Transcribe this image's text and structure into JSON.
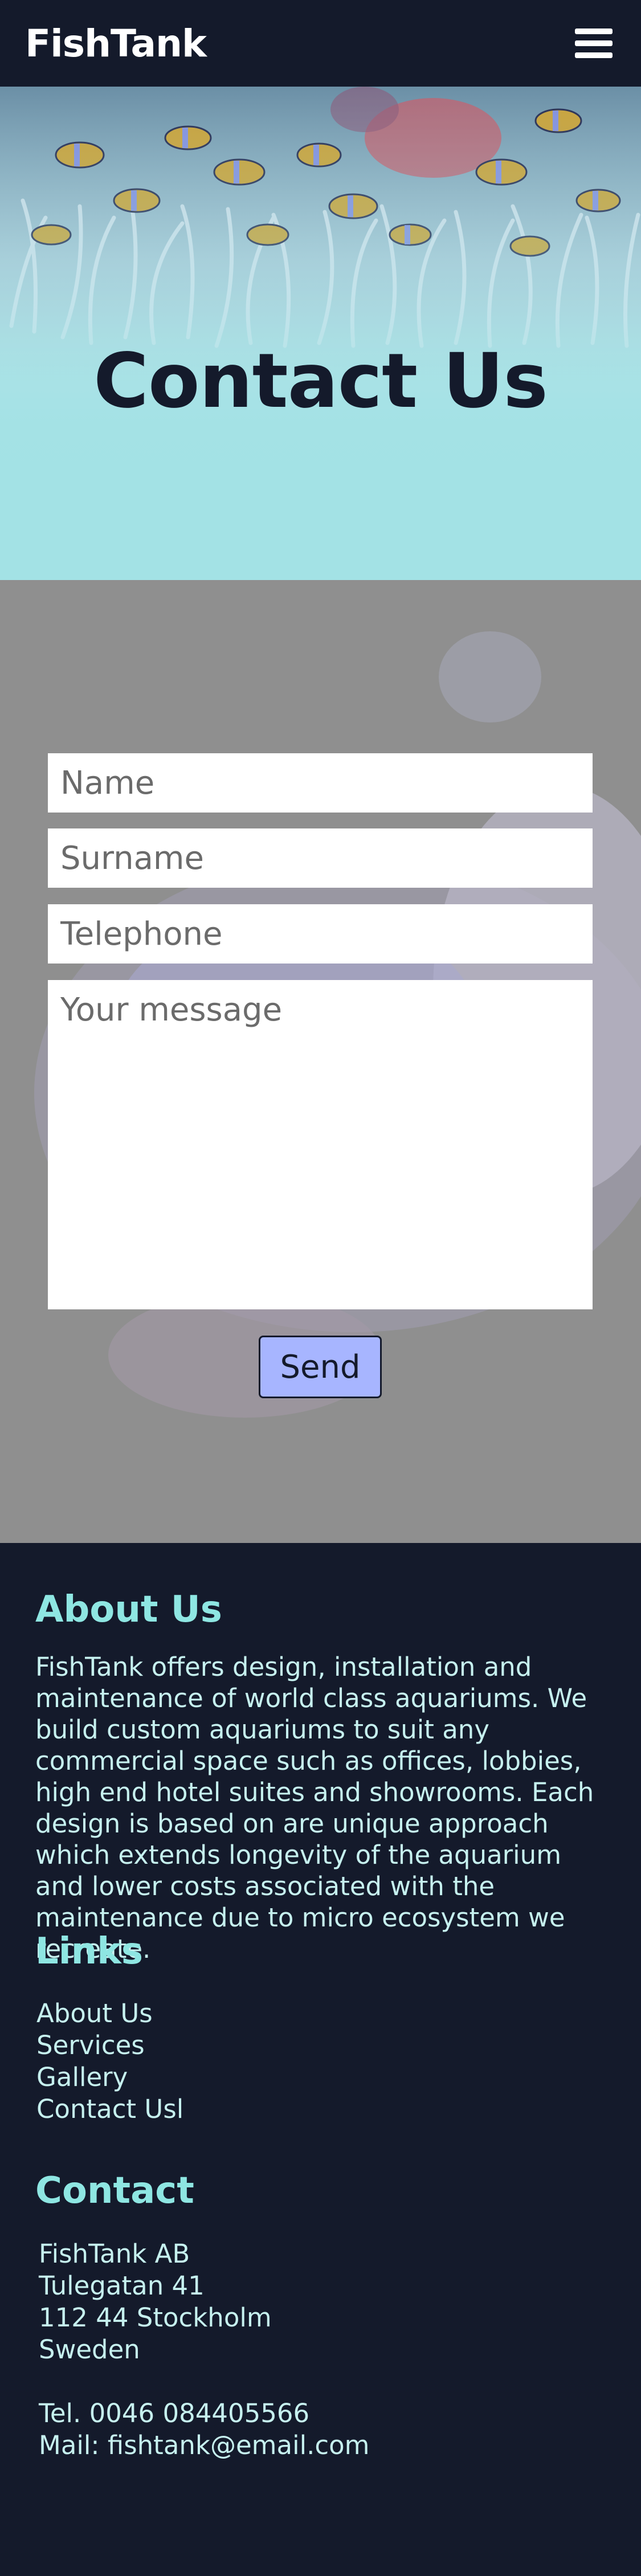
{
  "header": {
    "logo": "FishTank",
    "menu_icon": "hamburger-menu-icon"
  },
  "hero": {
    "title": "Contact Us"
  },
  "form": {
    "name_placeholder": "Name",
    "surname_placeholder": "Surname",
    "telephone_placeholder": "Telephone",
    "message_placeholder": "Your message",
    "send_label": "Send",
    "send_color": "#a7b5ff"
  },
  "footer": {
    "about": {
      "heading": "About Us",
      "text": "FishTank offers design, installation and maintenance of world class aquariums. We build custom aquariums to suit any commercial space such as offices, lobbies, high end hotel suites and showrooms. Each design is based on are unique approach which extends longevity of the aquarium and lower costs associated with the maintenance due to micro ecosystem we recreate."
    },
    "links": {
      "heading": "Links",
      "items": [
        "About Us",
        "Services",
        "Gallery",
        "Contact Usl"
      ]
    },
    "contact": {
      "heading": "Contact",
      "company": "FishTank AB",
      "street": "Tulegatan 41",
      "city": "112 44 Stockholm",
      "country": "Sweden",
      "phone": "Tel. 0046 084405566",
      "mail": "Mail: fishtank@email.com"
    }
  },
  "colors": {
    "navy": "#141a2b",
    "accent_teal": "#8ee6e2",
    "button": "#a7b5ff"
  }
}
